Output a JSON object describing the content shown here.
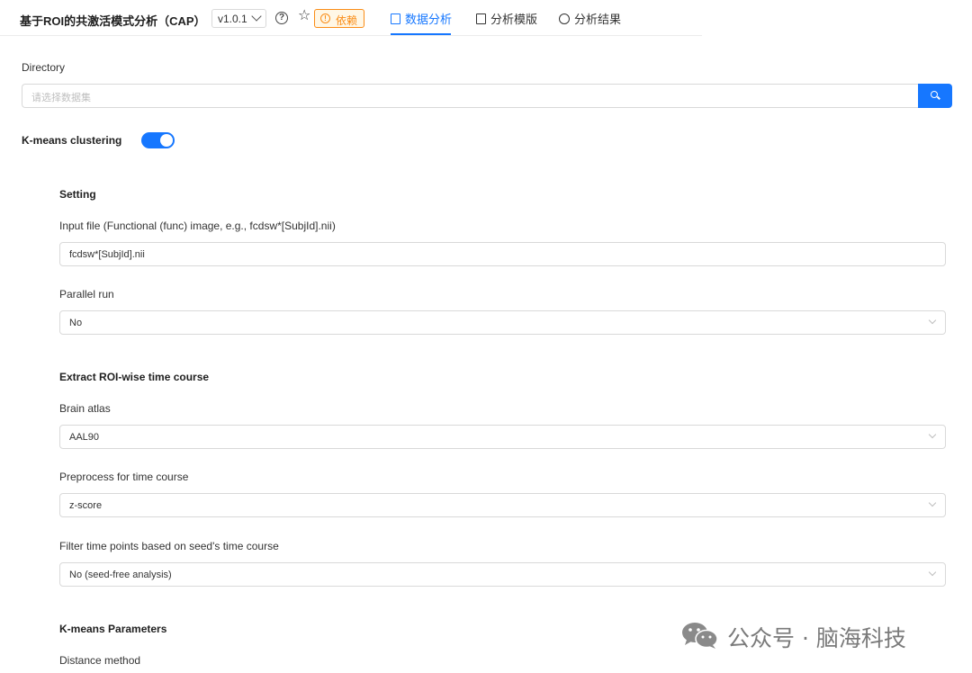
{
  "header": {
    "title": "基于ROI的共激活模式分析（CAP）",
    "version": "v1.0.1",
    "dependency_label": "依赖",
    "tabs": [
      {
        "label": "数据分析",
        "active": true
      },
      {
        "label": "分析模版",
        "active": false
      },
      {
        "label": "分析结果",
        "active": false
      }
    ]
  },
  "directory": {
    "label": "Directory",
    "placeholder": "请选择数据集"
  },
  "kmeans_toggle": {
    "label": "K-means clustering",
    "enabled": true
  },
  "setting": {
    "title": "Setting",
    "input_file_label": "Input file (Functional (func) image, e.g., fcdsw*[SubjId].nii)",
    "input_file_value": "fcdsw*[SubjId].nii",
    "parallel_label": "Parallel run",
    "parallel_value": "No"
  },
  "extract": {
    "title": "Extract ROI-wise time course",
    "atlas_label": "Brain atlas",
    "atlas_value": "AAL90",
    "preprocess_label": "Preprocess for time course",
    "preprocess_value": "z-score",
    "filter_label": "Filter time points based on seed's time course",
    "filter_value": "No (seed-free analysis)"
  },
  "kmeans_params": {
    "title": "K-means Parameters",
    "distance_label": "Distance method"
  },
  "watermark": {
    "text": "公众号 · 脑海科技"
  },
  "colors": {
    "primary": "#1677ff",
    "warning": "#fa8c16",
    "border": "#d9d9d9"
  }
}
